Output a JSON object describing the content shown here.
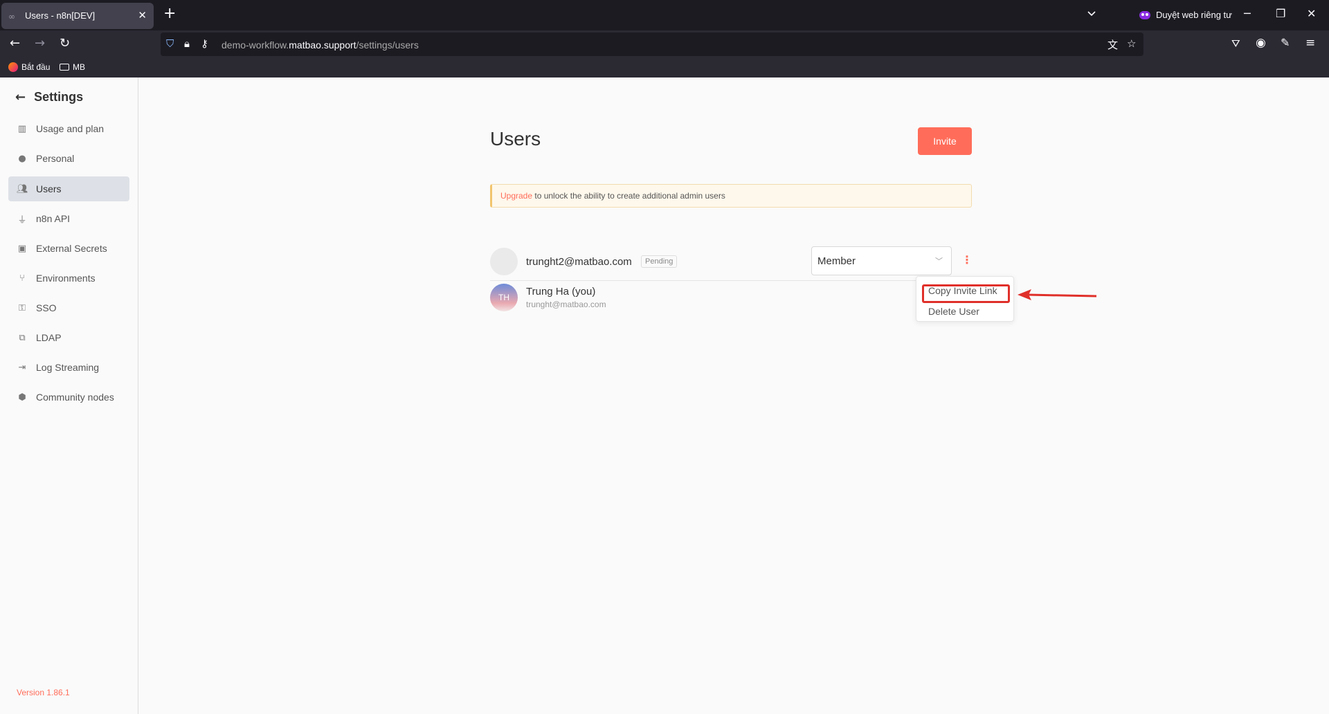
{
  "browser": {
    "tab_title": "Users - n8n[DEV]",
    "tab_favicon": "n8n-icon",
    "tab_close": "✕",
    "new_tab": "+",
    "private_label": "Duyệt web riêng tư",
    "url_prefix": "demo-workflow.",
    "url_domain": "matbao.support",
    "url_path": "/settings/users",
    "bookmarks": [
      {
        "label": "Bắt đầu",
        "icon": "firefox-icon"
      },
      {
        "label": "MB",
        "icon": "folder-icon"
      }
    ]
  },
  "sidebar": {
    "title": "Settings",
    "items": [
      {
        "label": "Usage and plan",
        "icon": "chart-icon",
        "active": false
      },
      {
        "label": "Personal",
        "icon": "user-circle-icon",
        "active": false
      },
      {
        "label": "Users",
        "icon": "users-icon",
        "active": true
      },
      {
        "label": "n8n API",
        "icon": "plug-icon",
        "active": false
      },
      {
        "label": "External Secrets",
        "icon": "vault-icon",
        "active": false
      },
      {
        "label": "Environments",
        "icon": "branch-icon",
        "active": false
      },
      {
        "label": "SSO",
        "icon": "user-lock-icon",
        "active": false
      },
      {
        "label": "LDAP",
        "icon": "network-icon",
        "active": false
      },
      {
        "label": "Log Streaming",
        "icon": "sign-in-icon",
        "active": false
      },
      {
        "label": "Community nodes",
        "icon": "cube-icon",
        "active": false
      }
    ],
    "version": "Version 1.86.1"
  },
  "main": {
    "title": "Users",
    "invite_label": "Invite",
    "banner": {
      "link": "Upgrade",
      "text": " to unlock the ability to create additional admin users"
    },
    "users": [
      {
        "email": "trunght2@matbao.com",
        "badge": "Pending",
        "role": "Member"
      },
      {
        "initials": "TH",
        "name": "Trung Ha (you)",
        "email": "trunght@matbao.com"
      }
    ],
    "menu": {
      "copy_invite": "Copy Invite Link",
      "delete_user": "Delete User"
    }
  },
  "colors": {
    "accent": "#ff6d5a",
    "annotation": "#e0302a",
    "chrome_dark": "#1c1b22",
    "chrome_mid": "#2b2a33"
  }
}
